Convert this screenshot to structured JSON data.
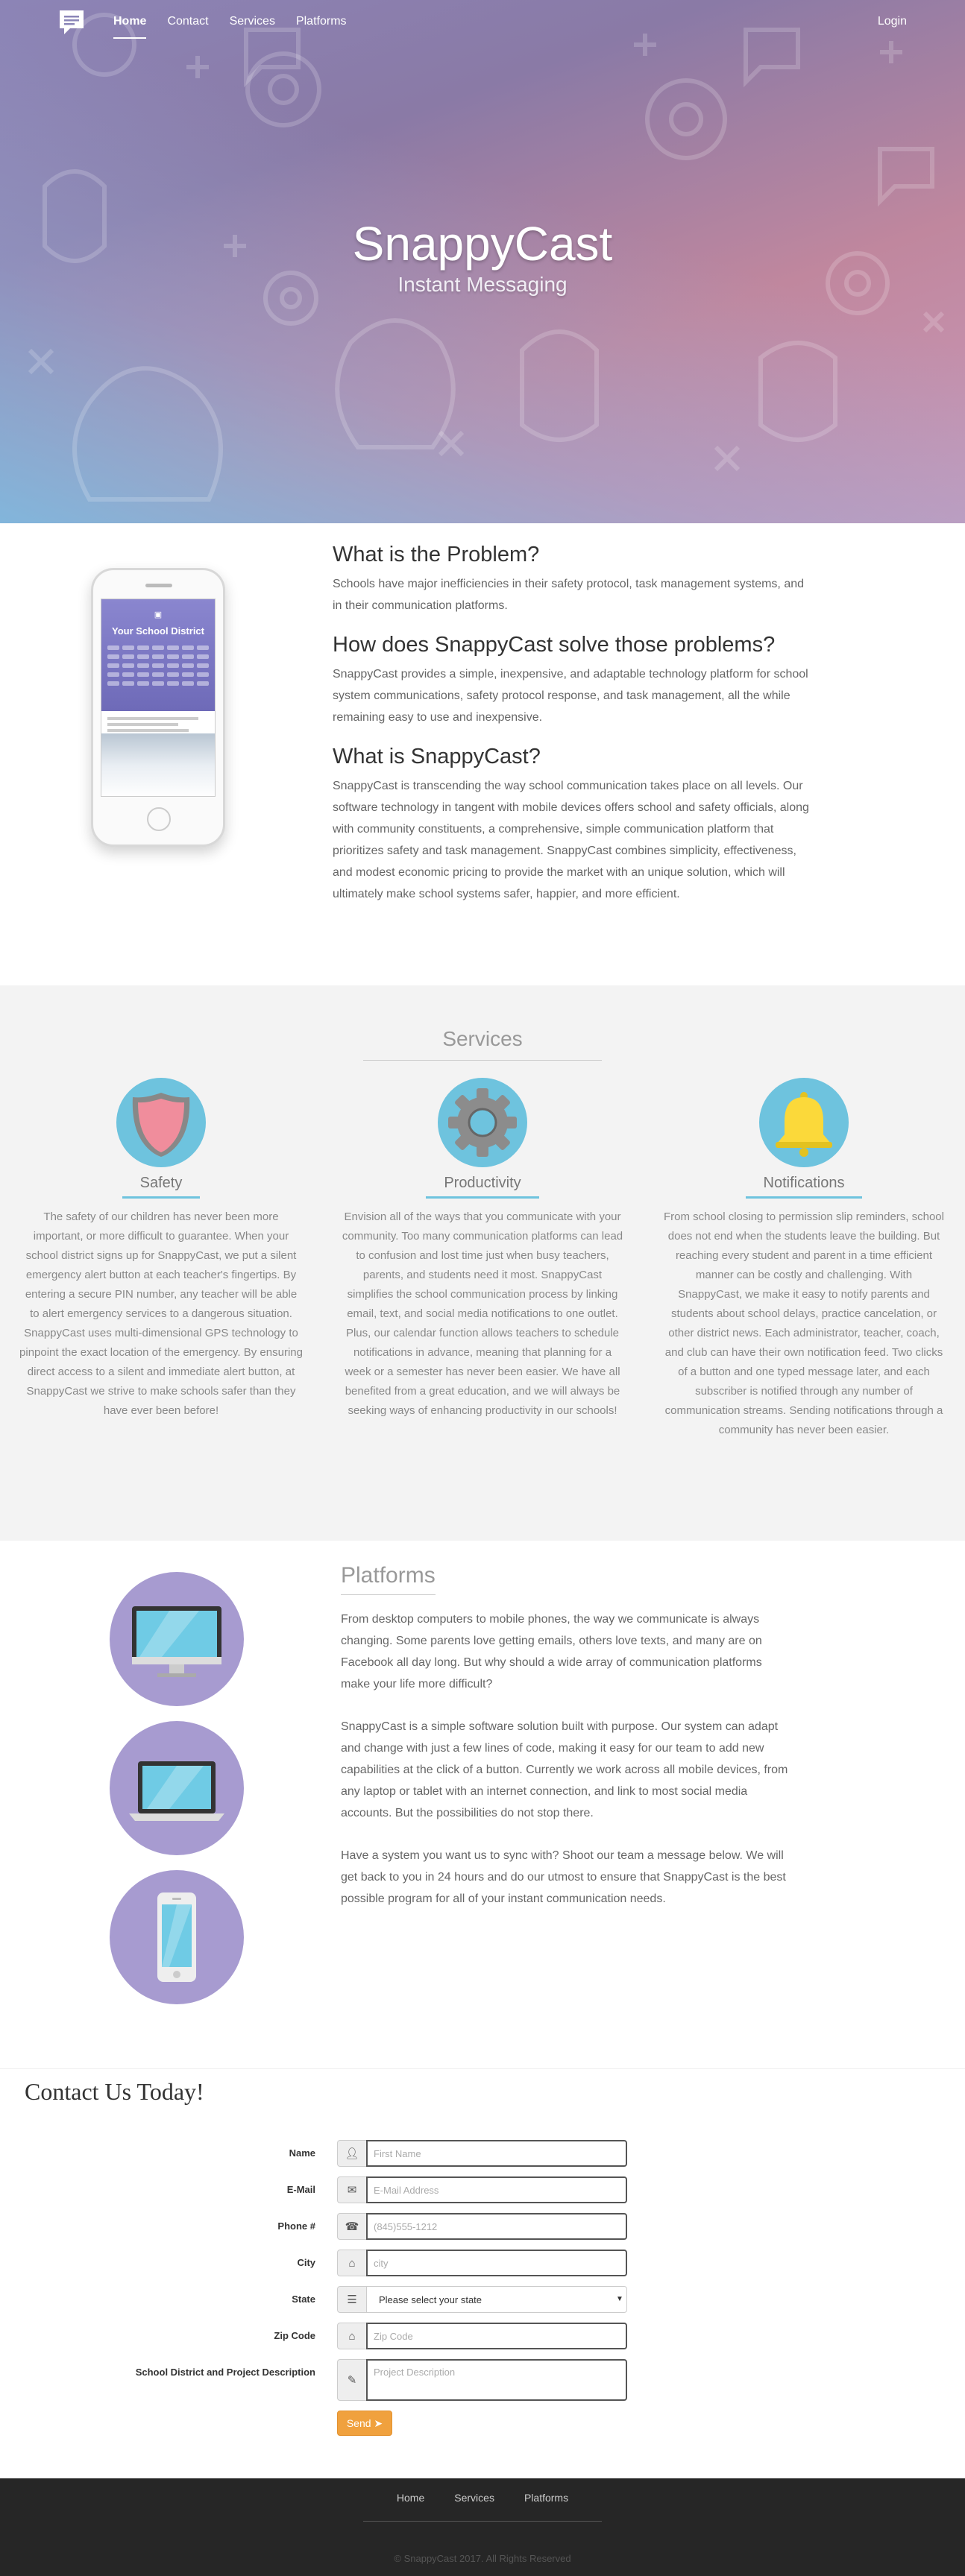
{
  "nav": {
    "items": [
      {
        "label": "Home",
        "active": true
      },
      {
        "label": "Contact"
      },
      {
        "label": "Services"
      },
      {
        "label": "Platforms"
      }
    ],
    "login": "Login",
    "logo_icon": "chat-bubble-icon"
  },
  "hero": {
    "title": "SnappyCast",
    "subtitle": "Instant Messaging"
  },
  "about": {
    "sections": [
      {
        "title": "What is the Problem?",
        "body": "Schools have major inefficiencies in their safety protocol, task management systems, and in their communication platforms."
      },
      {
        "title": "How does SnappyCast solve those problems?",
        "body": "SnappyCast provides a simple, inexpensive, and adaptable technology platform for school system communications, safety protocol response, and task management, all the while remaining easy to use and inexpensive."
      },
      {
        "title": "What is SnappyCast?",
        "body": "SnappyCast is transcending the way school communication takes place on all levels. Our software technology in tangent with mobile devices offers school and safety officials, along with community constituents, a comprehensive, simple communication platform that prioritizes safety and task management. SnappyCast combines simplicity, effectiveness, and modest economic pricing to provide the market with an unique solution, which will ultimately make school systems safer, happier, and more efficient."
      }
    ]
  },
  "services": {
    "title": "Services",
    "items": [
      {
        "title": "Safety",
        "icon": "shield-icon",
        "body": "The safety of our children has never been more important, or more difficult to guarantee. When your school district signs up for SnappyCast, we put a silent emergency alert button at each teacher's fingertips. By entering a secure PIN number, any teacher will be able to alert emergency services to a dangerous situation. SnappyCast uses multi-dimensional GPS technology to pinpoint the exact location of the emergency. By ensuring direct access to a silent and immediate alert button, at SnappyCast we strive to make schools safer than they have ever been before!"
      },
      {
        "title": "Productivity",
        "icon": "gear-icon",
        "body": "Envision all of the ways that you communicate with your community. Too many communication platforms can lead to confusion and lost time just when busy teachers, parents, and students need it most. SnappyCast simplifies the school communication process by linking email, text, and social media notifications to one outlet. Plus, our calendar function allows teachers to schedule notifications in advance, meaning that planning for a week or a semester has never been easier. We have all benefited from a great education, and we will always be seeking ways of enhancing productivity in our schools!"
      },
      {
        "title": "Notifications",
        "icon": "bell-icon",
        "body": "From school closing to permission slip reminders, school does not end when the students leave the building. But reaching every student and parent in a time efficient manner can be costly and challenging. With SnappyCast, we make it easy to notify parents and students about school delays, practice cancelation, or other district news. Each administrator, teacher, coach, and club can have their own notification feed. Two clicks of a button and one typed message later, and each subscriber is notified through any number of communication streams. Sending notifications through a community has never been easier."
      }
    ],
    "accent": "#6ec3de"
  },
  "platforms": {
    "title": "Platforms",
    "paragraphs": [
      "From desktop computers to mobile phones, the way we communicate is always changing. Some parents love getting emails, others love texts, and many are on Facebook all day long. But why should a wide array of communication platforms make your life more difficult?",
      "SnappyCast is a simple software solution built with purpose. Our system can adapt and change with just a few lines of code, making it easy for our team to add new capabilities at the click of a button. Currently we work across all mobile devices, from any laptop or tablet with an internet connection, and link to most social media accounts. But the possibilities do not stop there.",
      "Have a system you want us to sync with? Shoot our team a message below. We will get back to you in 24 hours and do our utmost to ensure that SnappyCast is the best possible program for all of your instant communication needs."
    ],
    "icons": [
      "desktop-icon",
      "laptop-icon",
      "smartphone-icon"
    ]
  },
  "contact": {
    "title": "Contact Us Today!",
    "fields": [
      {
        "label": "Name",
        "placeholder": "First Name",
        "icon": "user-icon"
      },
      {
        "label": "E-Mail",
        "placeholder": "E-Mail Address",
        "icon": "envelope-icon"
      },
      {
        "label": "Phone #",
        "placeholder": "(845)555-1212",
        "icon": "phone-icon"
      },
      {
        "label": "City",
        "placeholder": "city",
        "icon": "home-icon"
      },
      {
        "label": "State",
        "selected": "Please select your state",
        "icon": "list-icon"
      },
      {
        "label": "Zip Code",
        "placeholder": "Zip Code",
        "icon": "home-icon"
      },
      {
        "label": "School District and Project Description",
        "placeholder": "Project Description",
        "icon": "pencil-icon"
      }
    ],
    "send": "Send",
    "send_color": "#f0a13e"
  },
  "footer": {
    "links": [
      "Home",
      "Services",
      "Platforms"
    ],
    "copyright": "© SnappyCast 2017. All Rights Reserved"
  }
}
